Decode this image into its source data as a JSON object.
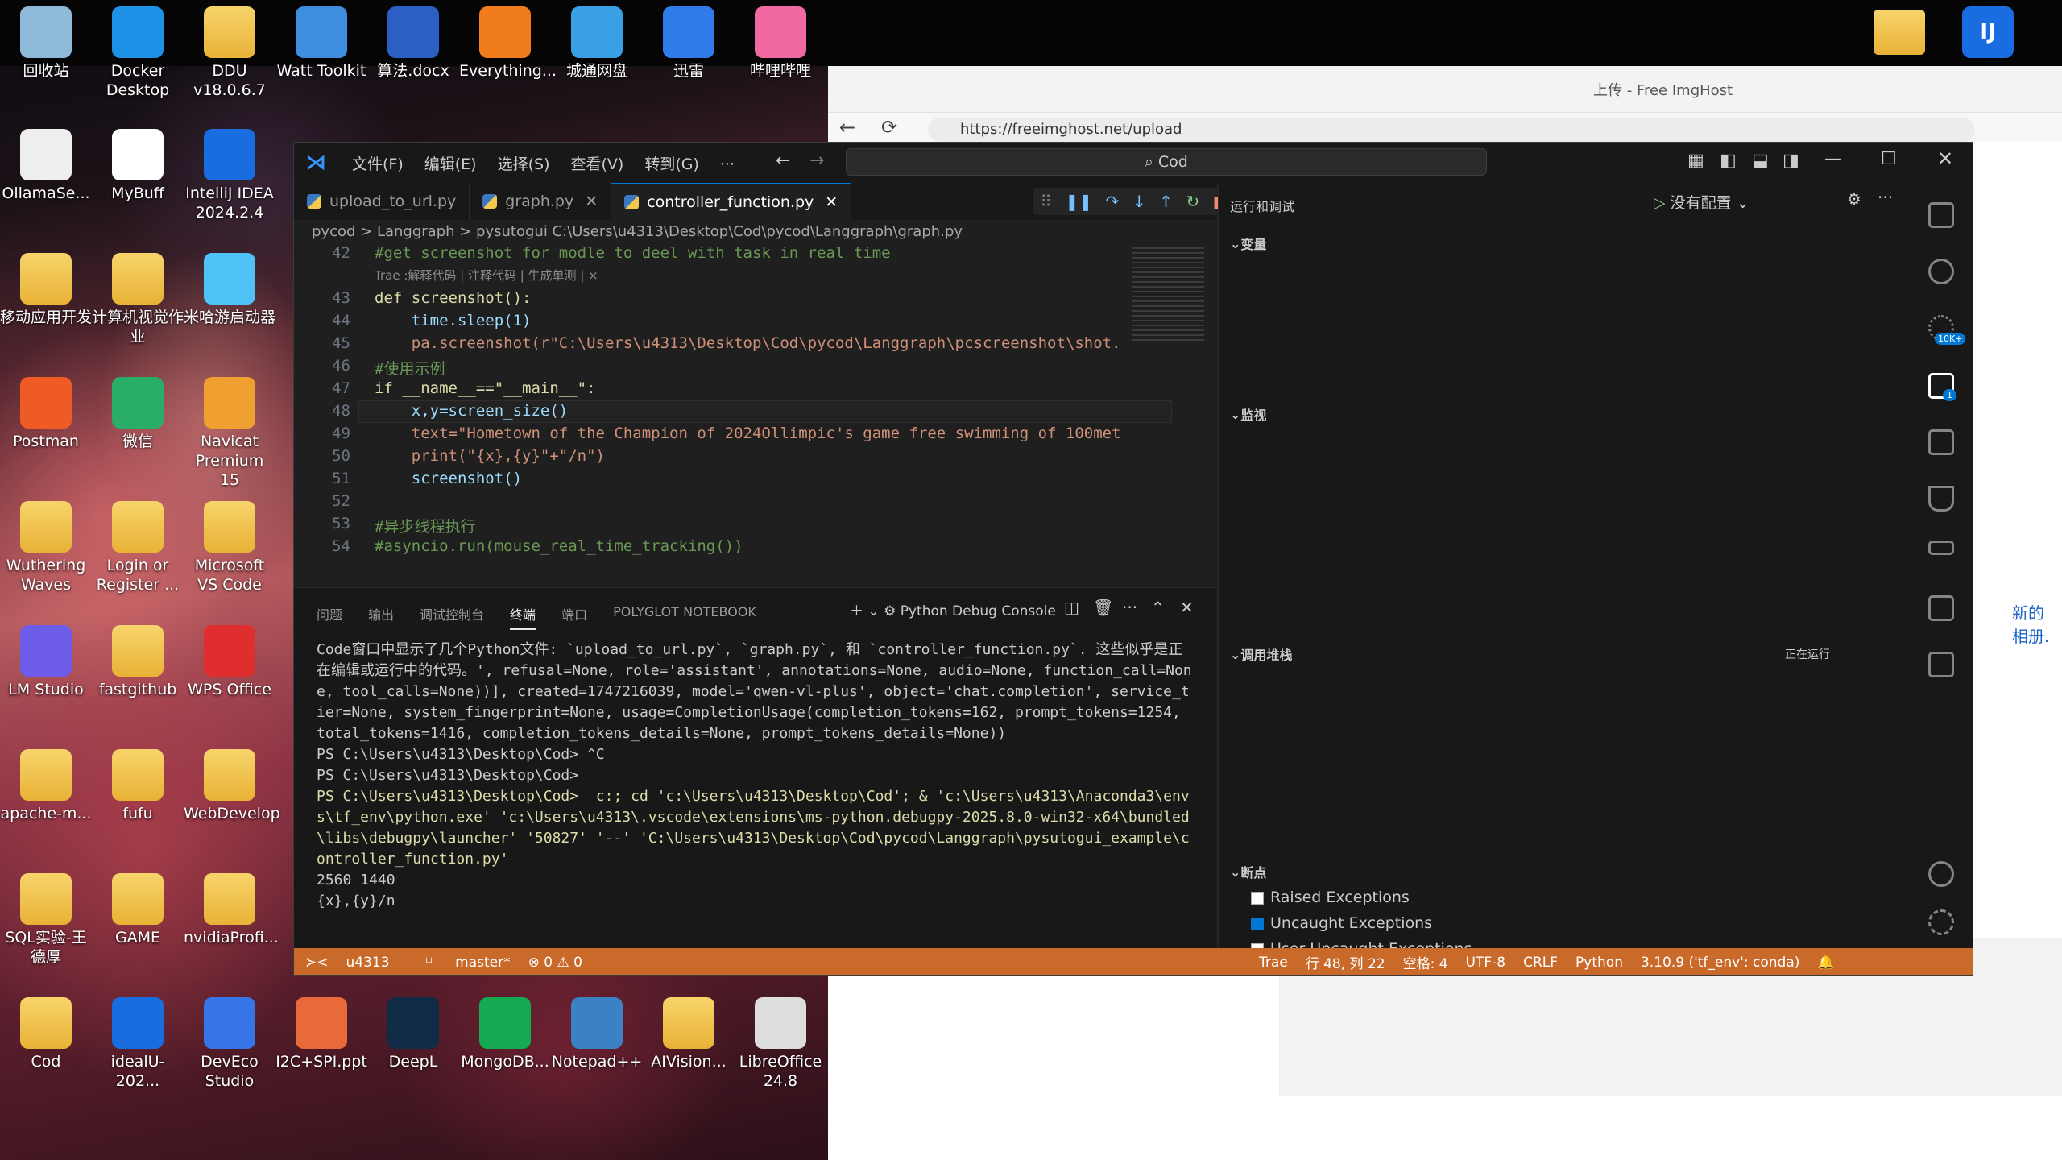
{
  "desktop_icons": [
    {
      "label": "回收站",
      "name": "recycle-bin-icon",
      "color": "#8fb9d9"
    },
    {
      "label": "Docker Desktop",
      "name": "docker-icon",
      "color": "#1d91e6"
    },
    {
      "label": "DDU v18.0.6.7",
      "name": "ddu-folder-icon",
      "color": "#e8b236"
    },
    {
      "label": "Watt Toolkit",
      "name": "watt-toolkit-icon",
      "color": "#3e8ee0"
    },
    {
      "label": "算法.docx",
      "name": "word-doc-icon",
      "color": "#2b5fc4"
    },
    {
      "label": "Everything...",
      "name": "everything-search-icon",
      "color": "#f07c1c"
    },
    {
      "label": "城通网盘",
      "name": "cloud-drive-icon",
      "color": "#39a0e6"
    },
    {
      "label": "迅雷",
      "name": "xunlei-icon",
      "color": "#2f7bea"
    },
    {
      "label": "哔哩哔哩",
      "name": "bilibili-icon",
      "color": "#f069a0"
    },
    {
      "label": "OllamaSe...",
      "name": "ollama-icon",
      "color": "#eeeeee"
    },
    {
      "label": "MyBuff",
      "name": "mybuff-icon",
      "color": "#ffffff"
    },
    {
      "label": "IntelliJ IDEA 2024.2.4",
      "name": "intellij-idea-icon",
      "color": "#1a6de0"
    },
    {
      "label": "移动应用开发",
      "name": "folder-icon",
      "color": "#e8b236"
    },
    {
      "label": "计算机视觉作业",
      "name": "folder-icon",
      "color": "#e8b236"
    },
    {
      "label": "米哈游启动器",
      "name": "mihoyo-launcher-icon",
      "color": "#4fc3f7"
    },
    {
      "label": "Postman",
      "name": "postman-icon",
      "color": "#ef5b25"
    },
    {
      "label": "微信",
      "name": "wechat-icon",
      "color": "#2aae67"
    },
    {
      "label": "Navicat Premium 15",
      "name": "navicat-icon",
      "color": "#f0a030"
    },
    {
      "label": "Wuthering Waves",
      "name": "folder-icon",
      "color": "#e8b236"
    },
    {
      "label": "Login or Register ...",
      "name": "folder-icon",
      "color": "#e8b236"
    },
    {
      "label": "Microsoft VS Code",
      "name": "folder-icon",
      "color": "#e8b236"
    },
    {
      "label": "LM Studio",
      "name": "lm-studio-icon",
      "color": "#6c5ce7"
    },
    {
      "label": "fastgithub",
      "name": "folder-icon",
      "color": "#e8b236"
    },
    {
      "label": "WPS Office",
      "name": "wps-office-icon",
      "color": "#e02e2e"
    },
    {
      "label": "apache-m...",
      "name": "folder-icon",
      "color": "#e8b236"
    },
    {
      "label": "fufu",
      "name": "folder-icon",
      "color": "#e8b236"
    },
    {
      "label": "WebDevelop",
      "name": "folder-icon",
      "color": "#e8b236"
    },
    {
      "label": "SQL实验-王德厚",
      "name": "folder-icon",
      "color": "#e8b236"
    },
    {
      "label": "GAME",
      "name": "folder-icon",
      "color": "#e8b236"
    },
    {
      "label": "nvidiaProfi...",
      "name": "folder-icon",
      "color": "#e8b236"
    },
    {
      "label": "Cod",
      "name": "folder-icon",
      "color": "#e8b236"
    },
    {
      "label": "idealU-202...",
      "name": "ideau-icon",
      "color": "#1a6de0"
    },
    {
      "label": "DevEco Studio",
      "name": "deveco-icon",
      "color": "#3575e8"
    },
    {
      "label": "I2C+SPI.ppt",
      "name": "ppt-icon",
      "color": "#e86a3a"
    },
    {
      "label": "DeepL",
      "name": "deepl-icon",
      "color": "#0f2b46"
    },
    {
      "label": "MongoDB...",
      "name": "mongodb-icon",
      "color": "#13aa52"
    },
    {
      "label": "Notepad++",
      "name": "notepadpp-icon",
      "color": "#3b82c4"
    },
    {
      "label": "AIVision...",
      "name": "aivision-folder-icon",
      "color": "#e8b236"
    },
    {
      "label": "LibreOffice 24.8",
      "name": "libreoffice-icon",
      "color": "#dddddd"
    }
  ],
  "browser": {
    "tab_title": "上传 - Free ImgHost",
    "url": "https://freeimghost.net/upload",
    "side_text": "新的 相册."
  },
  "vscode": {
    "menu": [
      "文件(F)",
      "编辑(E)",
      "选择(S)",
      "查看(V)",
      "转到(G)",
      "···"
    ],
    "search": "Cod",
    "tabs": [
      "upload_to_url.py",
      "graph.py",
      "controller_function.py"
    ],
    "breadcrumb": "pycod  >  Langgraph  >  pysutogui   C:\\Users\\u4313\\Desktop\\Cod\\pycod\\Langgraph\\graph.py",
    "code_lines": [
      {
        "n": "42",
        "t": "#get screenshot for modle to deel with task in real time"
      },
      {
        "n": "",
        "t": "Trae :解释代码 | 注释代码 | 生成单测 | ×"
      },
      {
        "n": "43",
        "t": "def screenshot():"
      },
      {
        "n": "44",
        "t": "    time.sleep(1)"
      },
      {
        "n": "45",
        "t": "    pa.screenshot(r\"C:\\Users\\u4313\\Desktop\\Cod\\pycod\\Langgraph\\pcscreenshot\\shot."
      },
      {
        "n": "46",
        "t": "#使用示例"
      },
      {
        "n": "47",
        "t": "if __name__==\"__main__\":"
      },
      {
        "n": "48",
        "t": "    x,y=screen_size()"
      },
      {
        "n": "49",
        "t": "    text=\"Hometown of the Champion of 2024Ollimpic's game free swimming of 100met"
      },
      {
        "n": "50",
        "t": "    print(\"{x},{y}\"+\"/n\")"
      },
      {
        "n": "51",
        "t": "    screenshot()"
      },
      {
        "n": "52",
        "t": ""
      },
      {
        "n": "53",
        "t": "#异步线程执行"
      },
      {
        "n": "54",
        "t": "#asyncio.run(mouse_real_time_tracking())"
      }
    ],
    "panel_tabs": [
      "问题",
      "输出",
      "调试控制台",
      "终端",
      "端口",
      "POLYGLOT NOTEBOOK"
    ],
    "debug_console": "Python Debug Console",
    "terminal": [
      "Code窗口中显示了几个Python文件: `upload_to_url.py`, `graph.py`, 和 `controller_function.py`. 这些似乎是正在编辑或运行中的代码。', refusal=None, role='assistant', annotations=None, audio=None, function_call=None, tool_calls=None))], created=1747216039, model='qwen-vl-plus', object='chat.completion', service_tier=None, system_fingerprint=None, usage=CompletionUsage(completion_tokens=162, prompt_tokens=1254, total_tokens=1416, completion_tokens_details=None, prompt_tokens_details=None))",
      "PS C:\\Users\\u4313\\Desktop\\Cod> ^C",
      "PS C:\\Users\\u4313\\Desktop\\Cod>",
      "PS C:\\Users\\u4313\\Desktop\\Cod>  c:; cd 'c:\\Users\\u4313\\Desktop\\Cod'; & 'c:\\Users\\u4313\\Anaconda3\\envs\\tf_env\\python.exe' 'c:\\Users\\u4313\\.vscode\\extensions\\ms-python.debugpy-2025.8.0-win32-x64\\bundled\\libs\\debugpy\\launcher' '50827' '--' 'C:\\Users\\u4313\\Desktop\\Cod\\pycod\\Langgraph\\pysutogui_example\\controller_function.py'",
      "2560 1440",
      "{x},{y}/n"
    ],
    "debug": {
      "title": "运行和调试",
      "config": "没有配置",
      "variables": "变量",
      "watch": "监视",
      "callstack": "调用堆栈",
      "running": "正在运行",
      "breakpoints": "断点",
      "bp_items": [
        {
          "label": "Raised Exceptions",
          "checked": false
        },
        {
          "label": "Uncaught Exceptions",
          "checked": true
        },
        {
          "label": "User Uncaught Exceptions",
          "checked": false
        }
      ]
    },
    "badges": {
      "source": "10K+",
      "debug": "1"
    },
    "status": {
      "user": "u4313",
      "branch": "master*",
      "problems": "⊗ 0 ⚠ 0",
      "trae": "Trae",
      "position": "行 48, 列 22",
      "spaces": "空格: 4",
      "encoding": "UTF-8",
      "eol": "CRLF",
      "lang": "Python",
      "interp": "3.10.9 ('tf_env': conda)"
    }
  }
}
